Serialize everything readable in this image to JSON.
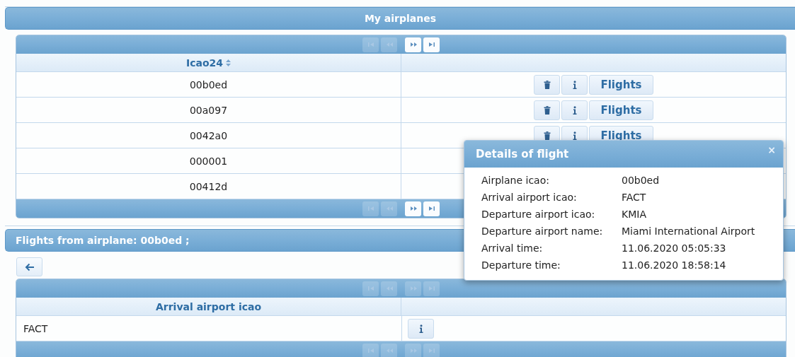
{
  "airplanes_panel": {
    "title": "My airplanes",
    "paginator_top": [
      {
        "kind": "first",
        "disabled": true
      },
      {
        "kind": "prev",
        "disabled": true
      },
      {
        "kind": "next",
        "disabled": false
      },
      {
        "kind": "last",
        "disabled": false
      }
    ],
    "columns": [
      {
        "label": "Icao24",
        "sortable": true
      }
    ],
    "rows": [
      {
        "icao24": "00b0ed",
        "actions": [
          {
            "kind": "delete"
          },
          {
            "kind": "info"
          },
          {
            "kind": "text",
            "label": "Flights"
          }
        ]
      },
      {
        "icao24": "00a097",
        "actions": [
          {
            "kind": "delete"
          },
          {
            "kind": "info"
          },
          {
            "kind": "text",
            "label": "Flights"
          }
        ]
      },
      {
        "icao24": "0042a0",
        "actions": [
          {
            "kind": "delete"
          },
          {
            "kind": "info"
          },
          {
            "kind": "text",
            "label": "Flights"
          }
        ]
      },
      {
        "icao24": "000001",
        "actions": []
      },
      {
        "icao24": "00412d",
        "actions": []
      }
    ],
    "paginator_bottom": [
      {
        "kind": "first",
        "disabled": true
      },
      {
        "kind": "prev",
        "disabled": true
      },
      {
        "kind": "next",
        "disabled": false
      },
      {
        "kind": "last",
        "disabled": false
      }
    ]
  },
  "flights_panel": {
    "title": "Flights from airplane: 00b0ed ;",
    "paginator_top": [
      {
        "kind": "first",
        "disabled": true
      },
      {
        "kind": "prev",
        "disabled": true
      },
      {
        "kind": "next",
        "disabled": true
      },
      {
        "kind": "last",
        "disabled": true
      }
    ],
    "columns": [
      {
        "label": "Arrival airport icao",
        "sortable": false
      }
    ],
    "rows": [
      {
        "arrival_icao": "FACT",
        "actions": [
          {
            "kind": "info"
          }
        ]
      }
    ],
    "paginator_bottom": [
      {
        "kind": "first",
        "disabled": true
      },
      {
        "kind": "prev",
        "disabled": true
      },
      {
        "kind": "next",
        "disabled": true
      },
      {
        "kind": "last",
        "disabled": true
      }
    ]
  },
  "dialog": {
    "title": "Details of flight",
    "close": "×",
    "fields": [
      {
        "label": "Airplane icao:",
        "value": "00b0ed"
      },
      {
        "label": "Arrival airport icao:",
        "value": "FACT"
      },
      {
        "label": "Departure airport icao:",
        "value": "KMIA"
      },
      {
        "label": "Departure airport name:",
        "value": "Miami International Airport"
      },
      {
        "label": "Arrival time:",
        "value": "11.06.2020 05:05:33"
      },
      {
        "label": "Departure time:",
        "value": "11.06.2020 18:58:14"
      }
    ]
  }
}
